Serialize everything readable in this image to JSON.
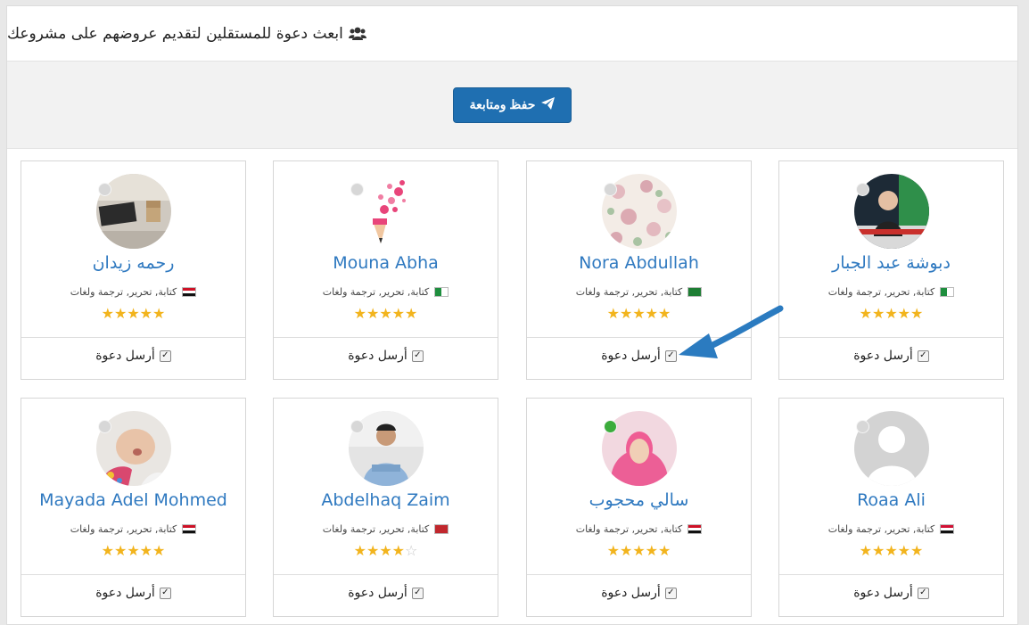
{
  "header": {
    "title": "ابعث دعوة للمستقلين لتقديم عروضهم على مشروعك",
    "icon": "users-icon"
  },
  "toolbar": {
    "save_label": "حفظ ومتابعة",
    "save_icon": "paper-plane-icon"
  },
  "common": {
    "skills": "كتابة, تحرير, ترجمة ولغات",
    "invite_label": "أرسل دعوة",
    "star_color": "#f2b41d",
    "name_color": "#2f79c0",
    "button_color": "#1f6fb1"
  },
  "freelancers": [
    {
      "name": "دبوشة عبد الجبار",
      "flag": "algeria",
      "rating": 5,
      "online": false,
      "invited": true
    },
    {
      "name": "Nora Abdullah",
      "flag": "saudi-arabia",
      "rating": 5,
      "online": false,
      "invited": true
    },
    {
      "name": "Mouna Abha",
      "flag": "algeria",
      "rating": 5,
      "online": false,
      "invited": true
    },
    {
      "name": "رحمه زيدان",
      "flag": "egypt",
      "rating": 5,
      "online": false,
      "invited": true
    },
    {
      "name": "Roaa Ali",
      "flag": "sudan",
      "rating": 5,
      "online": false,
      "invited": true
    },
    {
      "name": "سالي محجوب",
      "flag": "egypt",
      "rating": 5,
      "online": true,
      "invited": true
    },
    {
      "name": "Abdelhaq Zaim",
      "flag": "morocco",
      "rating": 4,
      "online": false,
      "invited": true
    },
    {
      "name": "Mayada Adel Mohmed",
      "flag": "egypt",
      "rating": 5,
      "online": false,
      "invited": true
    }
  ]
}
